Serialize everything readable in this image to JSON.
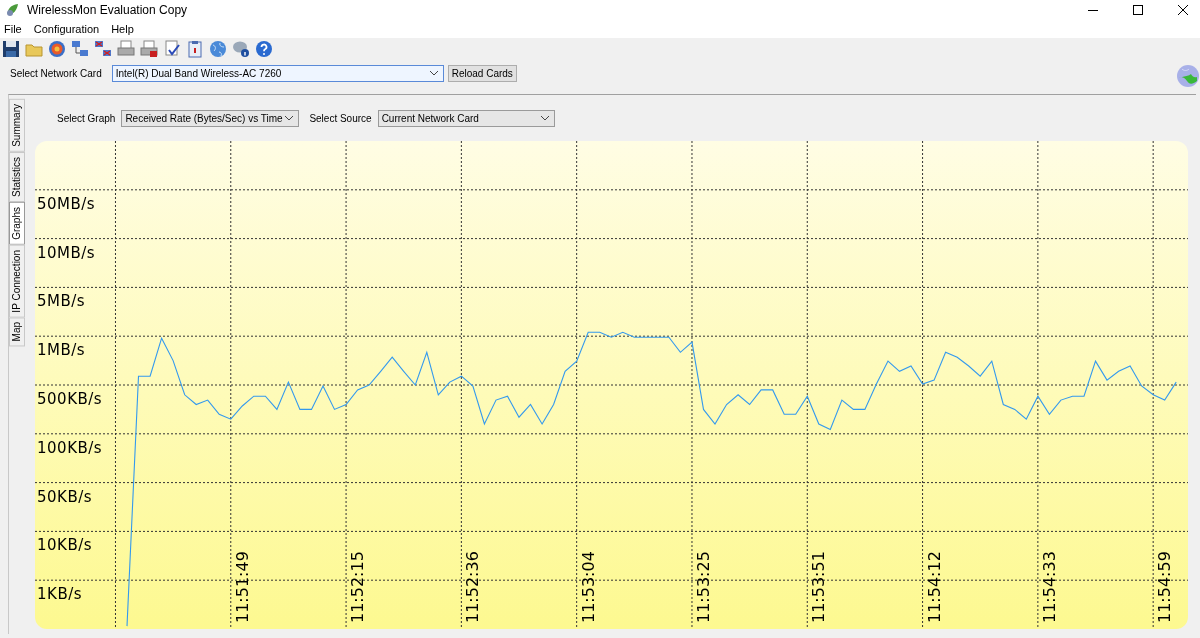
{
  "window": {
    "title": "WirelessMon Evaluation Copy"
  },
  "menu": [
    {
      "label": "File"
    },
    {
      "label": "Configuration"
    },
    {
      "label": "Help"
    }
  ],
  "network_card": {
    "label": "Select Network Card",
    "value": "Intel(R) Dual Band Wireless-AC 7260",
    "button": "Reload Cards"
  },
  "side_tabs": [
    {
      "label": "Summary",
      "selected": false
    },
    {
      "label": "Statistics",
      "selected": false
    },
    {
      "label": "Graphs",
      "selected": true
    },
    {
      "label": "IP Connection",
      "selected": false
    },
    {
      "label": "Map",
      "selected": false
    }
  ],
  "graph_controls": {
    "graph_label": "Select Graph",
    "graph_value": "Received Rate (Bytes/Sec) vs Time",
    "source_label": "Select Source",
    "source_value": "Current Network Card"
  },
  "graph": {
    "y_labels": [
      "50MB/s",
      "10MB/s",
      "5MB/s",
      "1MB/s",
      "500KB/s",
      "100KB/s",
      "50KB/s",
      "10KB/s",
      "1KB/s"
    ],
    "time_labels": [
      "11:51:49",
      "11:52:15",
      "11:52:36",
      "11:53:04",
      "11:53:25",
      "11:53:51",
      "11:54:12",
      "11:54:33",
      "11:54:59"
    ]
  }
}
